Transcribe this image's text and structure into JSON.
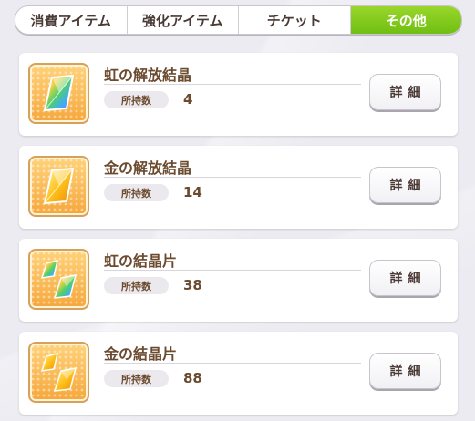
{
  "tabs": [
    {
      "label": "消費アイテム",
      "active": false
    },
    {
      "label": "強化アイテム",
      "active": false
    },
    {
      "label": "チケット",
      "active": false
    },
    {
      "label": "その他",
      "active": true
    }
  ],
  "items": [
    {
      "name": "虹の解放結晶",
      "owned_label": "所持数",
      "count": "4",
      "detail_label": "詳細",
      "icon": "rainbow-crystal-icon"
    },
    {
      "name": "金の解放結晶",
      "owned_label": "所持数",
      "count": "14",
      "detail_label": "詳細",
      "icon": "gold-crystal-icon"
    },
    {
      "name": "虹の結晶片",
      "owned_label": "所持数",
      "count": "38",
      "detail_label": "詳細",
      "icon": "rainbow-shard-icon"
    },
    {
      "name": "金の結晶片",
      "owned_label": "所持数",
      "count": "88",
      "detail_label": "詳細",
      "icon": "gold-shard-icon"
    }
  ],
  "colors": {
    "active_tab": "#79c41a",
    "text_brown": "#6b4a2e",
    "icon_frame": "#f6a73c"
  }
}
